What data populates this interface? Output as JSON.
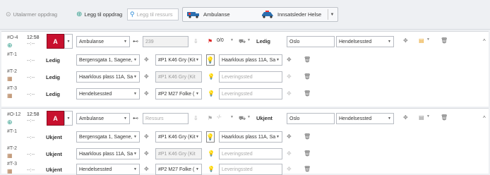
{
  "toolbar": {
    "utalarmer_label": "Utalarmer oppdrag",
    "legg_til_oppdrag_label": "Legg til oppdrag",
    "legg_til_ressurs_placeholder": "Legg til ressurs",
    "ambulanse_label": "Ambulanse",
    "innsatsleder_label": "Innsatsleder Helse"
  },
  "panels": [
    {
      "id": "#O-4",
      "time": "12:58",
      "time_sub": "--:--",
      "code": "A",
      "type": "Ambulanse",
      "resource": "239",
      "count": "0/0",
      "status": "Ledig",
      "region": "Oslo",
      "event": "Hendelsessted",
      "tasks": [
        {
          "id": "#T-1",
          "sub": "--:--",
          "status": "Ledig",
          "address": "Bergensgata 1, Sagene,",
          "unit": "#P1 K46 Gry (Kit",
          "dest": "Haarklous plass 11A, Sa",
          "unit_disabled": false,
          "dest_placeholder": false
        },
        {
          "id": "#T-2",
          "sub": "--:--",
          "status": "Ledig",
          "address": "Haarklous plass 11A, Sa",
          "unit": "#P1 K46 Gry (Kit",
          "dest": "Leveringssted",
          "unit_disabled": true,
          "dest_placeholder": true
        },
        {
          "id": "#T-3",
          "sub": "--:--",
          "status": "Ledig",
          "address": "Hendelsessted",
          "unit": "#P2 M27 Folke (",
          "dest": "Leveringssted",
          "unit_disabled": false,
          "dest_placeholder": true
        }
      ]
    },
    {
      "id": "#O-12",
      "time": "12:58",
      "time_sub": "--:--",
      "code": "A",
      "type": "Ambulanse",
      "resource": "Ressurs",
      "count": "-/-",
      "status": "Ukjent",
      "region": "Oslo",
      "event": "Hendelsessted",
      "tasks": [
        {
          "id": "#T-1",
          "sub": "--:--",
          "status": "Ukjent",
          "address": "Bergensgata 1, Sagene,",
          "unit": "#P1 K46 Gry (Kit",
          "dest": "Haarklous plass 11A, Sa",
          "unit_disabled": false,
          "dest_placeholder": false
        },
        {
          "id": "#T-2",
          "sub": "--:--",
          "status": "Ukjent",
          "address": "Haarklous plass 11A, Sa",
          "unit": "#P1 K46 Gry (Kit",
          "dest": "Leveringssted",
          "unit_disabled": true,
          "dest_placeholder": true
        },
        {
          "id": "#T-3",
          "sub": "--:--",
          "status": "Ukjent",
          "address": "Hendelsessted",
          "unit": "#P2 M27 Folke (",
          "dest": "Leveringssted",
          "unit_disabled": false,
          "dest_placeholder": true
        }
      ]
    }
  ],
  "colors": {
    "accent_red": "#c8102e",
    "accent_blue": "#2a8ad8",
    "brand_teal": "#2e9c8a"
  }
}
